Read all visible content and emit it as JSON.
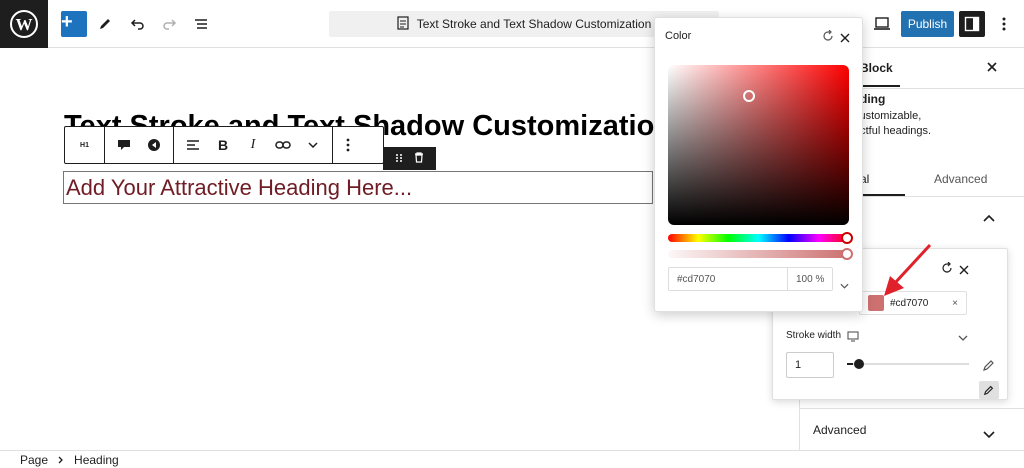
{
  "topbar": {
    "document_title": "Text Stroke and Text Shadow Customization",
    "publish_label": "Publish"
  },
  "editor": {
    "page_heading": "Text Stroke and Text Shadow Customization",
    "heading_block_text": "Add Your Attractive Heading Here...",
    "toolbar": {
      "heading_level": "H1"
    }
  },
  "sidebar": {
    "block_tab": "Block",
    "block_name": "ding",
    "desc_line1": "customizable,",
    "desc_line2": "actful headings.",
    "tab_general": "ral",
    "tab_advanced": "Advanced",
    "advanced_section": "Advanced"
  },
  "stroke_popover": {
    "color_value": "#cd7070",
    "stroke_width_label": "Stroke width",
    "stroke_width_value": "1"
  },
  "color_popover": {
    "title": "Color",
    "hex_value": "#cd7070",
    "alpha_value": "100 %"
  },
  "footer": {
    "crumb1": "Page",
    "crumb2": "Heading"
  },
  "colors": {
    "accent": "#2271b1",
    "heading_text": "#6f1c24",
    "selected_color": "#cd7070",
    "arrow": "#e0202a"
  }
}
